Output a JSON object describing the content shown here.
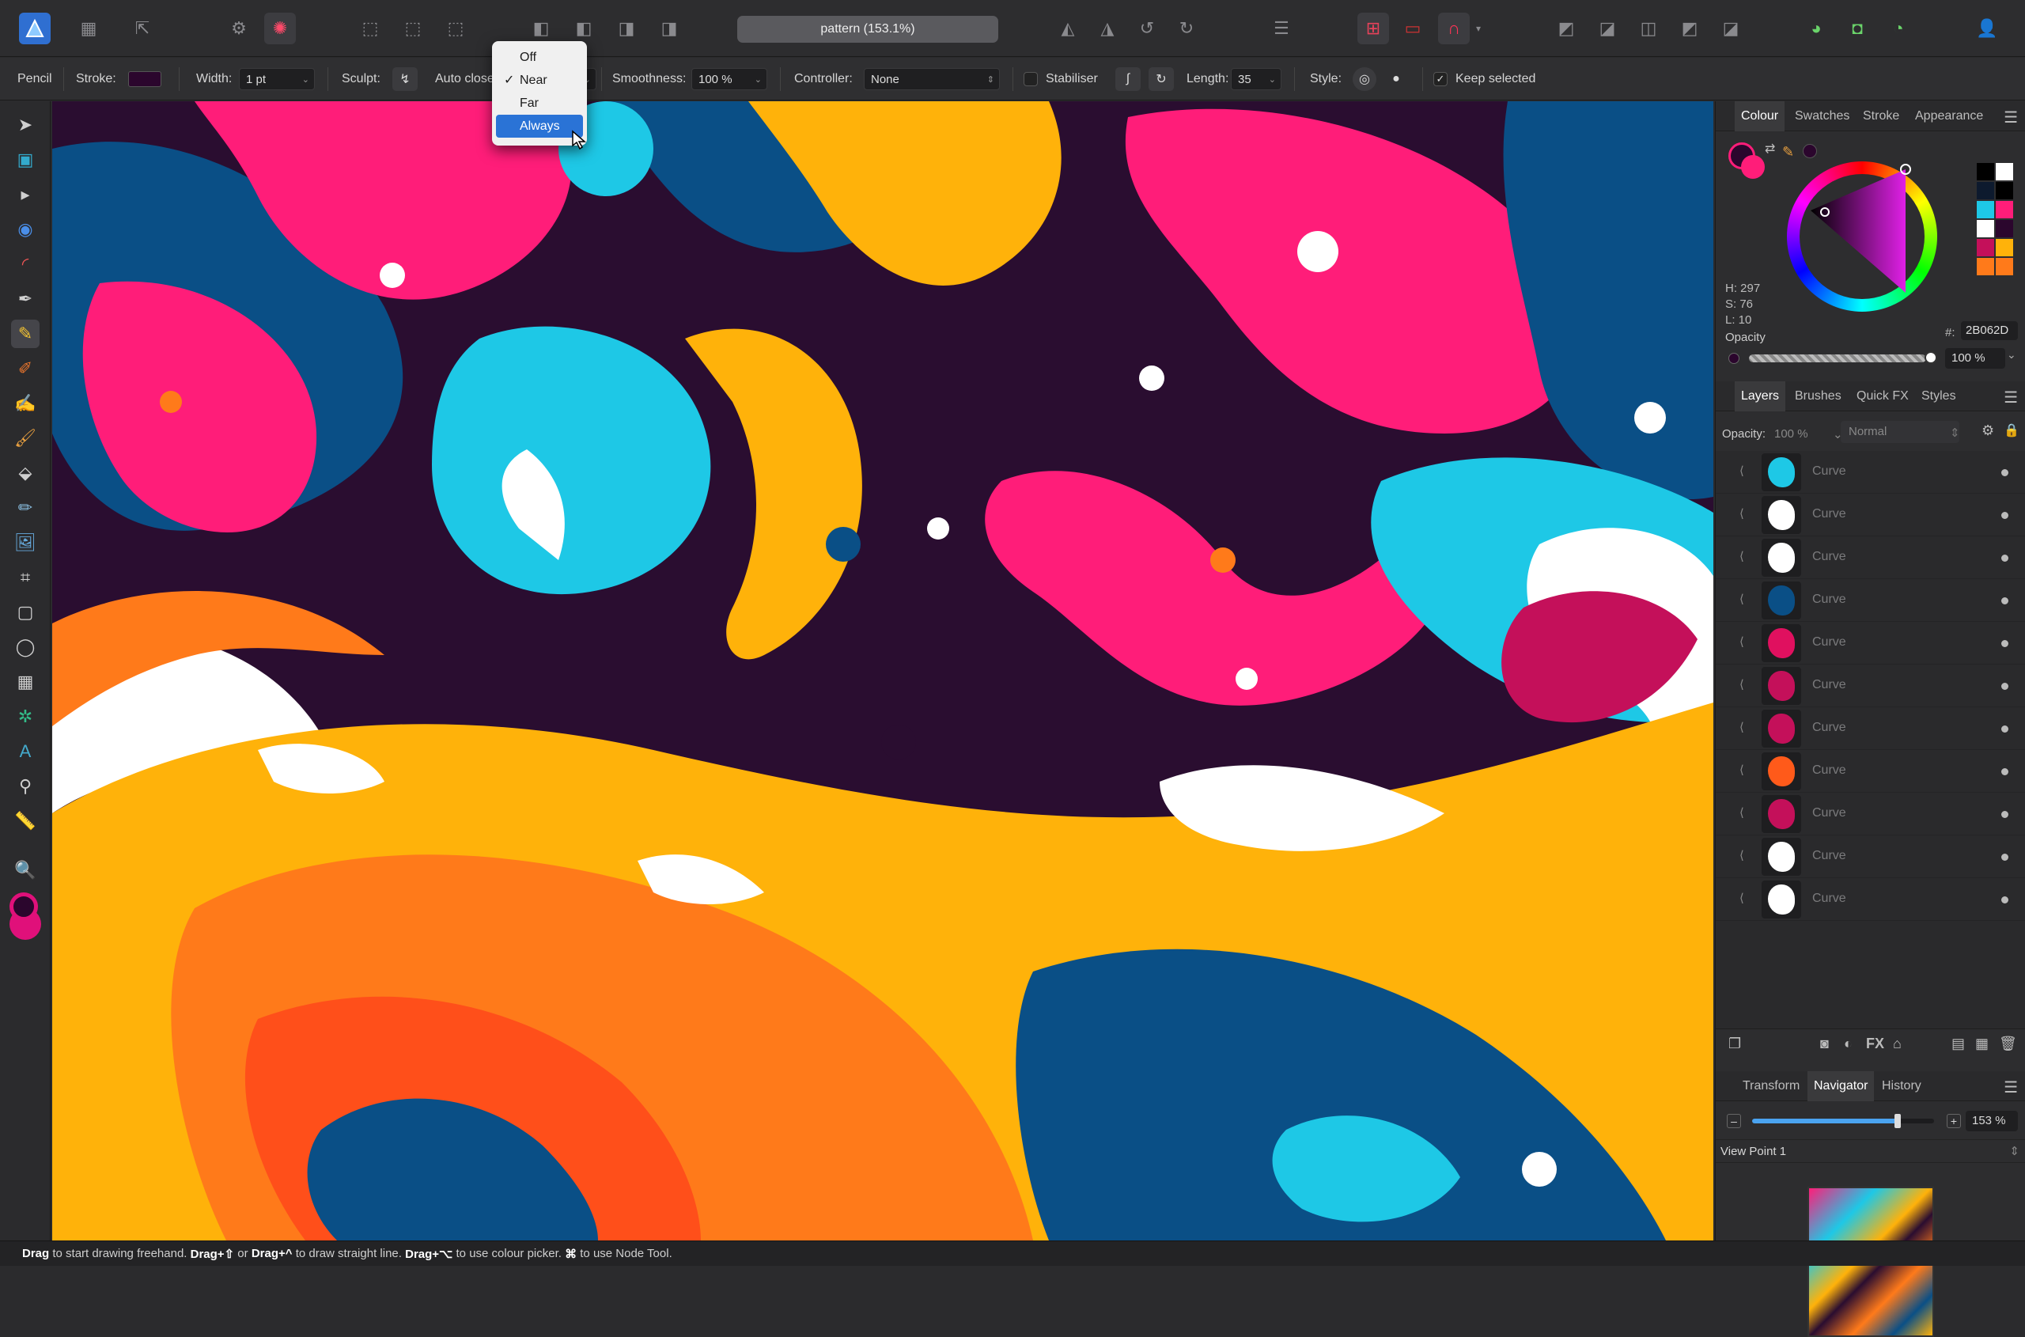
{
  "document": {
    "title": "pattern (153.1%)"
  },
  "context_toolbar": {
    "tool_name": "Pencil",
    "stroke_label": "Stroke:",
    "width_label": "Width:",
    "width_value": "1 pt",
    "sculpt_label": "Sculpt:",
    "auto_close_label": "Auto close",
    "smoothness_label": "Smoothness:",
    "smoothness_value": "100 %",
    "controller_label": "Controller:",
    "controller_value": "None",
    "stabiliser_label": "Stabiliser",
    "length_label": "Length:",
    "length_value": "35",
    "style_label": "Style:",
    "keep_selected_label": "Keep selected",
    "stroke_color": "#2B062D"
  },
  "auto_close_menu": {
    "options": [
      "Off",
      "Near",
      "Far",
      "Always"
    ],
    "checked": "Near",
    "highlighted": "Always",
    "check_mark": "✓"
  },
  "colour_panel": {
    "tabs": [
      "Colour",
      "Swatches",
      "Stroke",
      "Appearance"
    ],
    "active_tab": "Colour",
    "h": "H: 297",
    "s": "S: 76",
    "l": "L: 10",
    "hex_label": "#:",
    "hex_value": "2B062D",
    "opacity_label": "Opacity",
    "opacity_value": "100 %",
    "current_color": "#2B062D"
  },
  "layers_panel": {
    "tabs": [
      "Layers",
      "Brushes",
      "Quick FX",
      "Styles"
    ],
    "active_tab": "Layers",
    "opacity_label": "Opacity:",
    "opacity_value": "100 %",
    "blend_mode": "Normal",
    "layers": [
      {
        "name": "Curve",
        "thumb": "#1ec8e6"
      },
      {
        "name": "Curve",
        "thumb": "#ffffff"
      },
      {
        "name": "Curve",
        "thumb": "#ffffff"
      },
      {
        "name": "Curve",
        "thumb": "#0a4f86"
      },
      {
        "name": "Curve",
        "thumb": "#e0105f"
      },
      {
        "name": "Curve",
        "thumb": "#c4105a"
      },
      {
        "name": "Curve",
        "thumb": "#c4105a"
      },
      {
        "name": "Curve",
        "thumb": "#ff5a1a"
      },
      {
        "name": "Curve",
        "thumb": "#c4105a"
      },
      {
        "name": "Curve",
        "thumb": "#ffffff"
      },
      {
        "name": "Curve",
        "thumb": "#ffffff"
      }
    ]
  },
  "navigator_panel": {
    "tabs": [
      "Transform",
      "Navigator",
      "History"
    ],
    "active_tab": "Navigator",
    "zoom_value": "153 %",
    "view_point": "View Point 1",
    "zoom_fraction": 0.8
  },
  "status_bar": {
    "drag1": "Drag",
    "text1": " to start drawing freehand. ",
    "drag2": "Drag+⇧",
    "text2": " or ",
    "drag3": "Drag+^",
    "text3": " to draw straight line. ",
    "drag4": "Drag+⌥",
    "text4": " to use colour picker. ",
    "cmd": "⌘",
    "text5": " to use Node Tool."
  }
}
